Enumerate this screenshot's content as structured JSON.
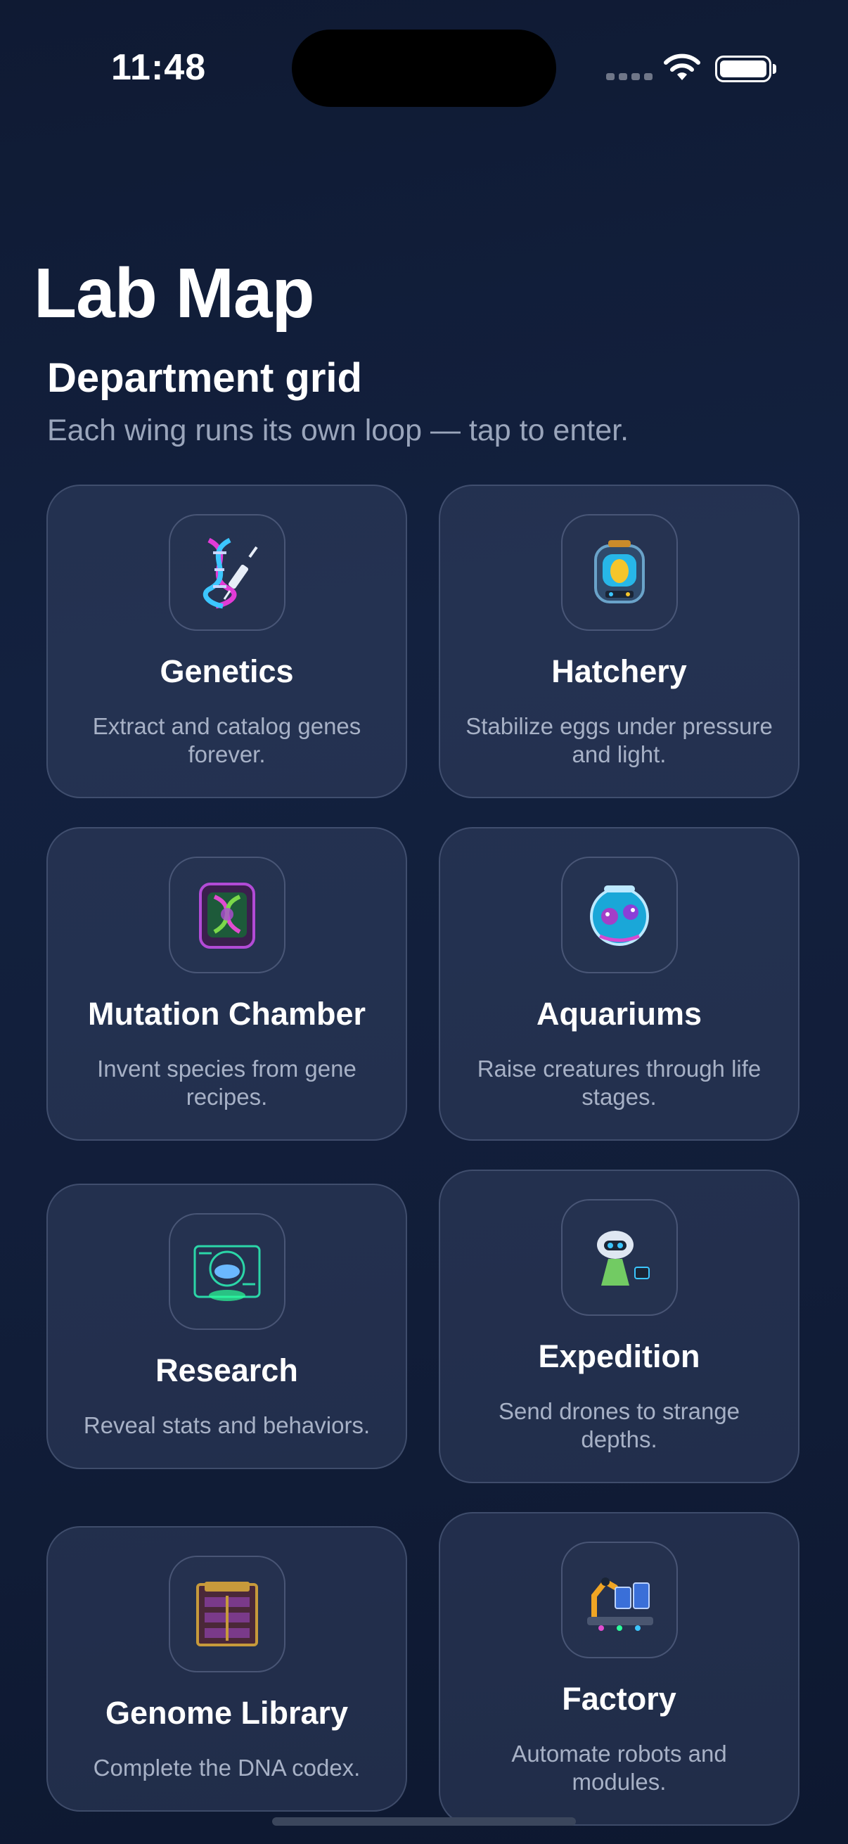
{
  "status_bar": {
    "time": "11:48"
  },
  "header": {
    "title": "Lab Map",
    "section_title": "Department grid",
    "section_subtitle": "Each wing runs its own loop — tap to enter."
  },
  "departments": [
    {
      "title": "Genetics",
      "description": "Extract and catalog genes forever.",
      "icon": "dna-syringe-icon"
    },
    {
      "title": "Hatchery",
      "description": "Stabilize eggs under pressure and light.",
      "icon": "incubator-egg-icon"
    },
    {
      "title": "Mutation Chamber",
      "description": "Invent species from gene recipes.",
      "icon": "mutation-chamber-icon"
    },
    {
      "title": "Aquariums",
      "description": "Raise creatures through life stages.",
      "icon": "fishbowl-icon"
    },
    {
      "title": "Research",
      "description": "Reveal stats and behaviors.",
      "icon": "research-hologram-icon"
    },
    {
      "title": "Expedition",
      "description": "Send drones to strange depths.",
      "icon": "drone-robot-icon"
    },
    {
      "title": "Genome Library",
      "description": "Complete the DNA codex.",
      "icon": "genome-library-icon"
    },
    {
      "title": "Factory",
      "description": "Automate robots and modules.",
      "icon": "factory-robot-arm-icon"
    }
  ]
}
